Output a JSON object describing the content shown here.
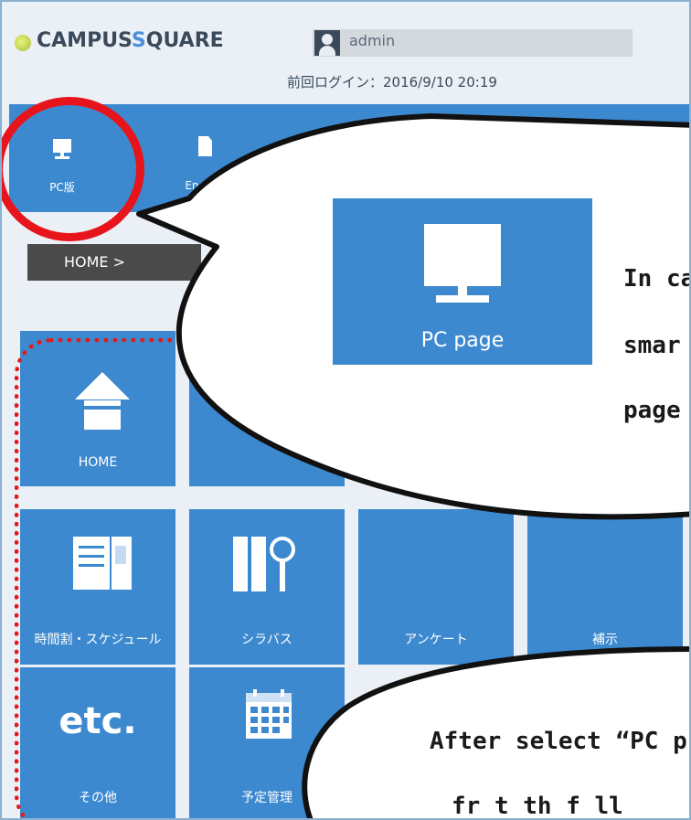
{
  "header": {
    "logo_part1": "CAMPUS",
    "logo_part2": "S",
    "logo_part3": "QUARE",
    "username": "admin",
    "last_login": "前回ログイン：2016/9/10 20:19"
  },
  "topbar": {
    "buttons": [
      {
        "label": "PC版",
        "icon": "monitor-icon"
      },
      {
        "label": "English",
        "icon": "document-icon"
      },
      {
        "label": "",
        "icon": "clock-icon"
      }
    ]
  },
  "breadcrumb": "HOME >",
  "tiles": [
    {
      "label": "HOME",
      "icon": "house-icon"
    },
    {
      "label": "",
      "icon": "tile-icon"
    },
    {
      "label": "時間割・スケジュール",
      "icon": "book-icon"
    },
    {
      "label": "シラバス",
      "icon": "binder-search-icon"
    },
    {
      "label": "アンケート",
      "icon": "survey-icon"
    },
    {
      "label": "補示",
      "icon": "notice-icon"
    },
    {
      "label": "その他",
      "icon": "etc-icon",
      "big_text": "etc."
    },
    {
      "label": "予定管理",
      "icon": "calendar-icon"
    }
  ],
  "callout1": {
    "tile_label": "PC page",
    "line1": "In ca",
    "line2": "smar",
    "line3": "page"
  },
  "callout2": {
    "line1": "After select “PC p",
    "line2": "fr  t  th  f ll"
  },
  "colors": {
    "tile_blue": "#3d89cf",
    "highlight_red": "#e8141b",
    "breadcrumb_bg": "#4a4a4a"
  }
}
